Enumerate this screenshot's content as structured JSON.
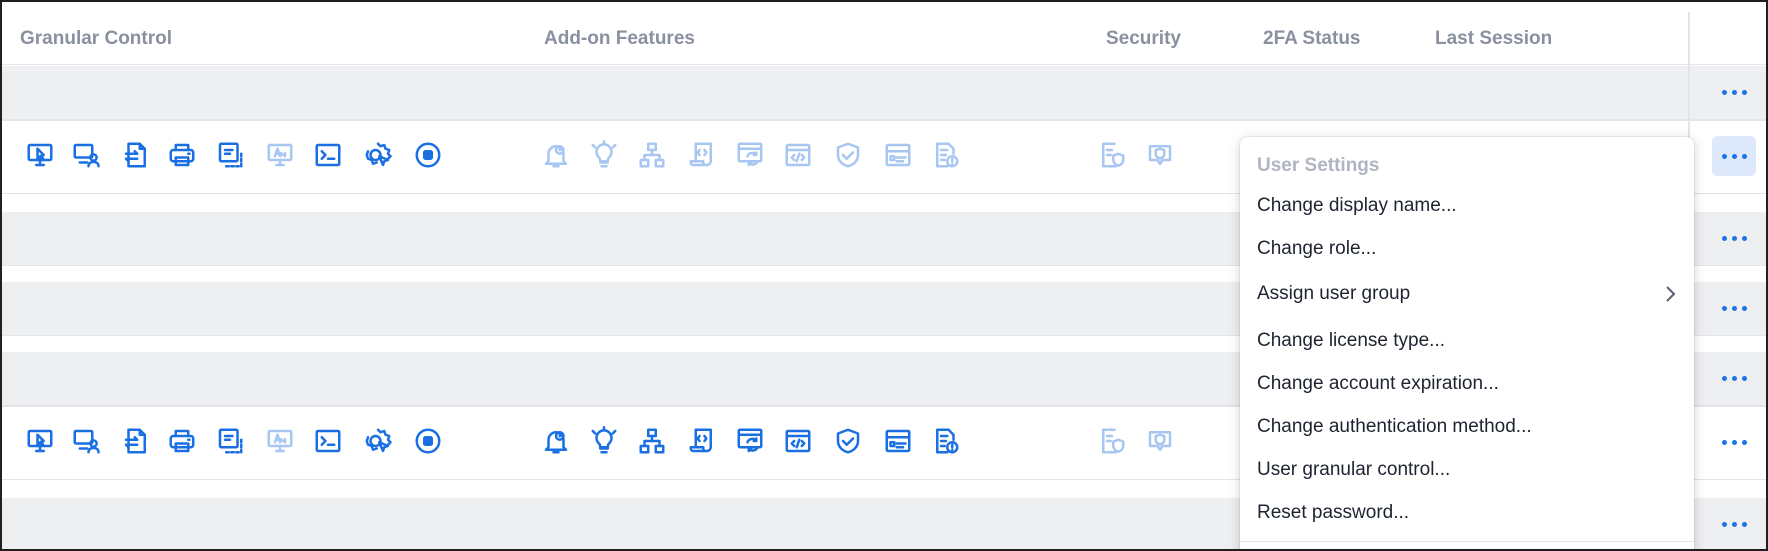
{
  "header": {
    "granular_control": "Granular Control",
    "addon_features": "Add-on Features",
    "security": "Security",
    "twofa_status": "2FA Status",
    "last_session": "Last Session"
  },
  "granular_icons": [
    "remote-control-icon",
    "remote-user-icon",
    "file-transfer-icon",
    "print-icon",
    "clipboard-icon",
    "blank-screen-icon",
    "terminal-icon",
    "system-settings-icon",
    "record-session-icon"
  ],
  "granular_icon_state_rows": [
    [
      true,
      true,
      true,
      true,
      true,
      false,
      true,
      true,
      true
    ],
    [
      true,
      true,
      true,
      true,
      true,
      false,
      true,
      true,
      true
    ]
  ],
  "addon_icons": [
    "alert-bell-icon",
    "idea-icon",
    "network-icon",
    "script-icon",
    "refresh-window-icon",
    "code-window-icon",
    "shield-icon",
    "form-list-icon",
    "report-alert-icon"
  ],
  "addon_enabled_rows": [
    false,
    true
  ],
  "security_icons": [
    "device-shield-icon",
    "verified-chat-icon"
  ],
  "context_menu": {
    "title": "User Settings",
    "items": [
      "Change display name...",
      "Change role...",
      "Assign user group",
      "Change license type...",
      "Change account expiration...",
      "Change authentication method...",
      "User granular control...",
      "Reset password..."
    ],
    "submenu_item": "Assign user group"
  },
  "colors": {
    "accent": "#1a6fe3",
    "accent_disabled": "#a8c6f2",
    "row_gray": "#eeeff1",
    "header_text": "#8a90a0",
    "menu_title": "#b0b5c1"
  }
}
